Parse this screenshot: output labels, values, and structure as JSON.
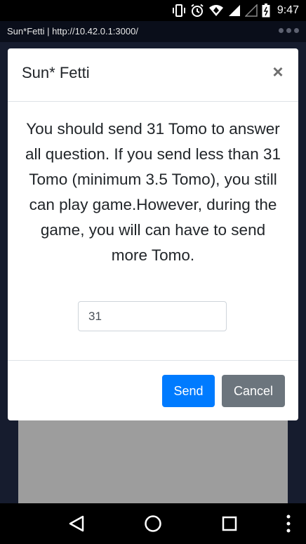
{
  "status_bar": {
    "time": "9:47",
    "icons": [
      "vibrate-icon",
      "alarm-icon",
      "wifi-icon",
      "signal-icon",
      "signal-empty-icon",
      "battery-icon"
    ]
  },
  "browser": {
    "title": "Sun*Fetti | http://10.42.0.1:3000/",
    "menu_icon": "overflow-dots-icon"
  },
  "modal": {
    "title": "Sun* Fetti",
    "close_label": "×",
    "message": "You should send 31 Tomo to answer all question. If you send less than 31 Tomo (minimum 3.5 Tomo), you still can play game.However, during the game, you will can have to send more Tomo.",
    "amount_value": "31",
    "send_label": "Send",
    "cancel_label": "Cancel"
  },
  "nav_bar": {
    "icons": [
      "back-icon",
      "home-icon",
      "recents-icon",
      "more-icon"
    ]
  },
  "colors": {
    "primary": "#007bff",
    "secondary": "#6c757d",
    "backdrop": "#141b2e"
  }
}
